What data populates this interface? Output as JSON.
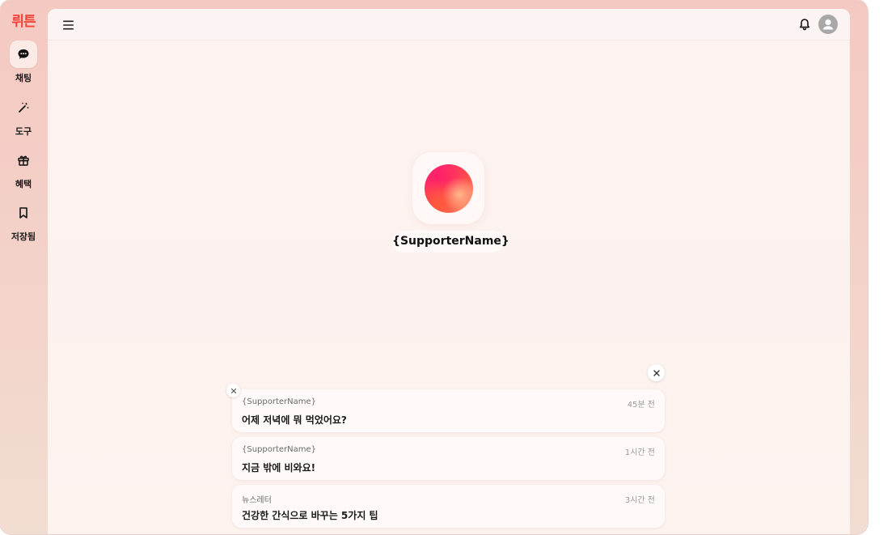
{
  "app": {
    "logo_text": "뤼튼",
    "brand_color": "#f0443a"
  },
  "sidebar": {
    "items": [
      {
        "label": "채팅",
        "icon": "chat-bubble-icon",
        "active": true
      },
      {
        "label": "도구",
        "icon": "magic-wand-icon",
        "active": false
      },
      {
        "label": "혜택",
        "icon": "gift-icon",
        "active": false
      },
      {
        "label": "저장됨",
        "icon": "bookmark-icon",
        "active": false
      }
    ]
  },
  "topbar": {
    "menu_icon": "hamburger-menu-icon",
    "bell_icon": "bell-icon",
    "avatar_icon": "user-avatar-icon"
  },
  "supporter": {
    "name": "{SupporterName}"
  },
  "notifications": [
    {
      "sender": "{SupporterName}",
      "time": "45분 전",
      "message": "어제 저녁에 뭐 먹었어요?"
    },
    {
      "sender": "{SupporterName}",
      "time": "1시간 전",
      "message": "지금 밖에 비와요!"
    },
    {
      "sender": "뉴스레터",
      "time": "3시간 전",
      "message": "건강한 간식으로 바꾸는 5가지 팁"
    }
  ]
}
